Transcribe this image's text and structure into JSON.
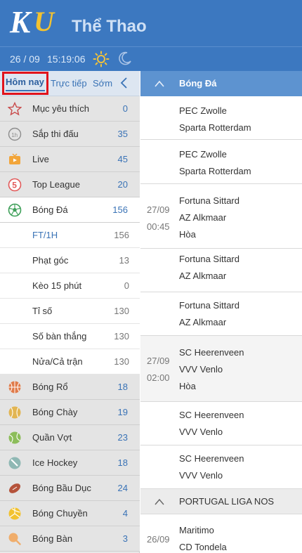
{
  "header": {
    "logo_text": "KU",
    "title": "Thể Thao",
    "date": "26 / 09",
    "time": "15:19:06",
    "sun_icon": "sun-icon",
    "moon_icon": "moon-icon"
  },
  "tabs": [
    {
      "label": "Hôm nay",
      "active": true
    },
    {
      "label": "Trực tiếp"
    },
    {
      "label": "Sớm"
    }
  ],
  "categories_top": [
    {
      "label": "Mục yêu thích",
      "count": "0",
      "icon": "star-icon"
    },
    {
      "label": "Sắp thi đấu",
      "count": "35",
      "icon": "clock-icon"
    },
    {
      "label": "Live",
      "count": "45",
      "icon": "tv-icon"
    },
    {
      "label": "Top League",
      "count": "20",
      "icon": "top5-icon"
    },
    {
      "label": "Bóng Đá",
      "count": "156",
      "icon": "soccer-ball-icon"
    }
  ],
  "soccer_sub": [
    {
      "label": "FT/1H",
      "count": "156"
    },
    {
      "label": "Phạt góc",
      "count": "13"
    },
    {
      "label": "Kèo 15 phút",
      "count": "0"
    },
    {
      "label": "Tỉ số",
      "count": "130"
    },
    {
      "label": "Số bàn thắng",
      "count": "130"
    },
    {
      "label": "Nửa/Cả trận",
      "count": "130"
    }
  ],
  "categories_bottom": [
    {
      "label": "Bóng Rổ",
      "count": "18",
      "icon": "basketball-icon"
    },
    {
      "label": "Bóng Chày",
      "count": "19",
      "icon": "baseball-icon"
    },
    {
      "label": "Quần Vợt",
      "count": "23",
      "icon": "tennis-icon"
    },
    {
      "label": "Ice Hockey",
      "count": "18",
      "icon": "hockey-icon"
    },
    {
      "label": "Bóng Bầu Dục",
      "count": "24",
      "icon": "rugby-icon"
    },
    {
      "label": "Bóng Chuyền",
      "count": "4",
      "icon": "volleyball-icon"
    },
    {
      "label": "Bóng Bàn",
      "count": "3",
      "icon": "table-tennis-icon"
    }
  ],
  "right": {
    "section_label": "Bóng Đá",
    "matches": [
      {
        "home": "PEC Zwolle",
        "away": "Sparta Rotterdam"
      },
      {
        "home": "PEC Zwolle",
        "away": "Sparta Rotterdam"
      },
      {
        "date": "27/09",
        "time": "00:45",
        "home": "Fortuna Sittard",
        "away": "AZ Alkmaar",
        "draw": "Hòa"
      },
      {
        "home": "Fortuna Sittard",
        "away": "AZ Alkmaar"
      },
      {
        "home": "Fortuna Sittard",
        "away": "AZ Alkmaar"
      },
      {
        "date": "27/09",
        "time": "02:00",
        "home": "SC Heerenveen",
        "away": "VVV Venlo",
        "draw": "Hòa"
      },
      {
        "home": "SC Heerenveen",
        "away": "VVV Venlo"
      },
      {
        "home": "SC Heerenveen",
        "away": "VVV Venlo"
      }
    ],
    "league2": "PORTUGAL LIGA NOS",
    "match_last": {
      "date": "26/09",
      "home": "Maritimo",
      "away": "CD Tondela"
    }
  }
}
